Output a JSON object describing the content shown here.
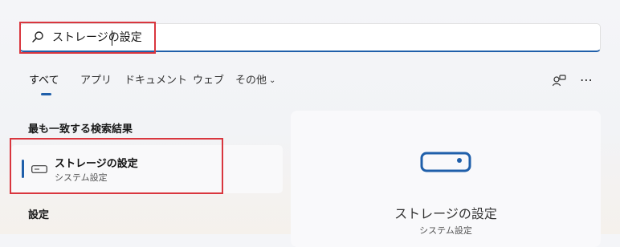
{
  "search": {
    "query": "ストレージの設定"
  },
  "tabs": [
    {
      "label": "すべて",
      "active": true
    },
    {
      "label": "アプリ"
    },
    {
      "label": "ドキュメント"
    },
    {
      "label": "ウェブ"
    },
    {
      "label": "その他"
    }
  ],
  "toolbar": {
    "more_label": "⋯"
  },
  "best_match": {
    "heading": "最も一致する検索結果",
    "title": "ストレージの設定",
    "subtitle": "システム設定"
  },
  "settings_section": {
    "heading": "設定"
  },
  "preview": {
    "title": "ストレージの設定",
    "subtitle": "システム設定"
  },
  "colors": {
    "accent": "#1f5faa",
    "highlight": "#d9363e"
  },
  "icons": [
    "search-icon",
    "chevron-down-icon",
    "account-icon",
    "more-icon",
    "drive-icon"
  ]
}
